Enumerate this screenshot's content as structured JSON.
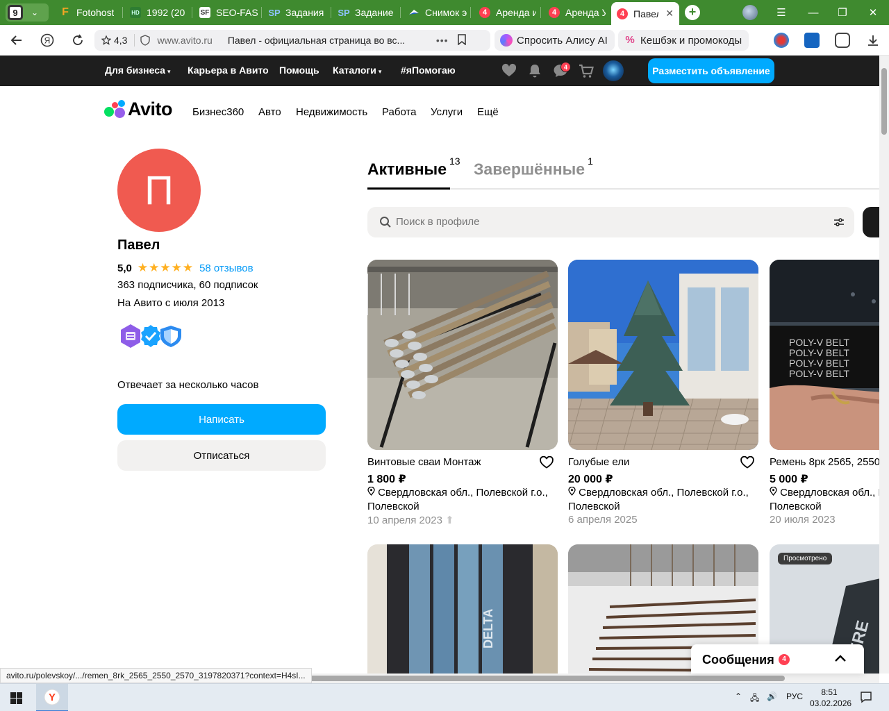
{
  "browser": {
    "tab_counter": "9",
    "tabs": [
      {
        "label": "Fotohost",
        "fav": "F",
        "fav_color": "#f5a623"
      },
      {
        "label": "1992 (20",
        "fav": "HD",
        "fav_color": "#2e7d32"
      },
      {
        "label": "SEO-FAS",
        "fav": "SF",
        "fav_color": "#555555"
      },
      {
        "label": "Задания",
        "fav": "SP",
        "fav_color": "#4a90d9"
      },
      {
        "label": "Задание",
        "fav": "SP",
        "fav_color": "#4a90d9"
      },
      {
        "label": "Снимок э",
        "fav": "",
        "fav_color": "#1e5fd4"
      },
      {
        "label": "Аренда и",
        "fav": "4",
        "fav_color": "#ff4053"
      },
      {
        "label": "Аренда У",
        "fav": "4",
        "fav_color": "#ff4053"
      }
    ],
    "active_tab": {
      "label": "Павел",
      "fav": "4"
    },
    "new_tab": "+",
    "address": {
      "rating": "4,3",
      "host": "www.avito.ru",
      "title": "Павел - официальная страница во вс..."
    },
    "alice_label": "Спросить Алису AI",
    "cashback_label": "Кешбэк и промокоды"
  },
  "avito_topbar": {
    "links": [
      "Для бизнеса",
      "Карьера в Авито",
      "Помощь",
      "Каталоги",
      "#яПомогаю"
    ],
    "messages_badge": "4",
    "post_button": "Разместить объявление"
  },
  "header": {
    "logo_text": "Avito",
    "categories": [
      "Бизнес360",
      "Авто",
      "Недвижимость",
      "Работа",
      "Услуги",
      "Ещё"
    ]
  },
  "profile": {
    "avatar_letter": "П",
    "name": "Павел",
    "rating": "5,0",
    "stars": "★★★★★",
    "reviews": "58 отзывов",
    "followers": "363 подписчика, 60 подписок",
    "since": "На Авито с июля 2013",
    "response": "Отвечает за несколько часов",
    "write_button": "Написать",
    "unsubscribe_button": "Отписаться"
  },
  "listings": {
    "tab_active": "Активные",
    "tab_active_count": "13",
    "tab_done": "Завершённые",
    "tab_done_count": "1",
    "search_placeholder": "Поиск в профиле",
    "cards": [
      {
        "title": "Винтовые сваи Монтаж",
        "price": "1 800 ₽",
        "location": "Свердловская обл., Полевской г.о., Полевской",
        "date": "10 апреля 2023"
      },
      {
        "title": "Голубые ели",
        "price": "20 000 ₽",
        "location": "Свердловская обл., Полевской г.о., Полевской",
        "date": "6 апреля 2025"
      },
      {
        "title": "Ремень 8рк 2565, 2550",
        "price": "5 000 ₽",
        "location": "Свердловская обл., Полевской г.о., Полевской",
        "date": "20 июля 2023"
      }
    ],
    "belt_text": "POLY-V BELT",
    "delta_text": "DELTA",
    "viewed_tag": "Просмотрено"
  },
  "messages_widget": {
    "label": "Сообщения",
    "badge": "4"
  },
  "status_url": "avito.ru/polevskoy/.../remen_8rk_2565_2550_2570_3197820371?context=H4sI...",
  "taskbar": {
    "lang": "РУС",
    "time": "8:51",
    "date": "03.02.2026"
  }
}
